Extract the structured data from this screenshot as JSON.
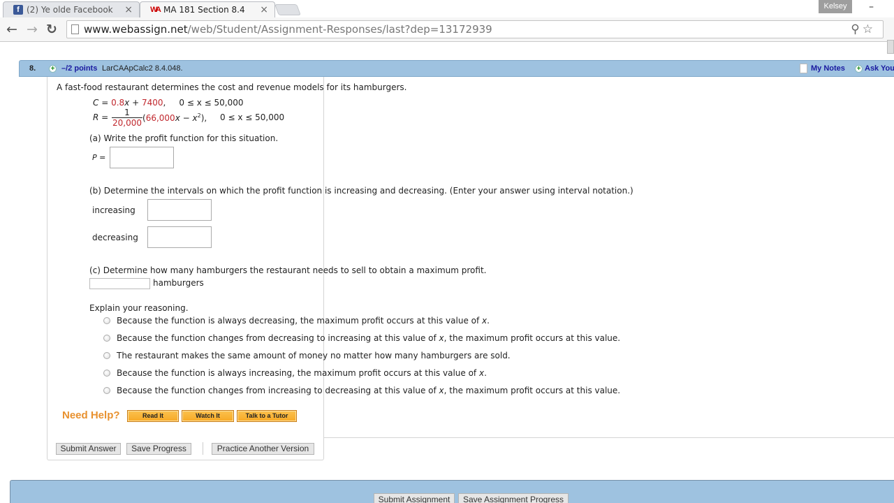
{
  "browser": {
    "tabs": [
      {
        "label": "(2) Ye olde Facebook",
        "favicon": "facebook-icon",
        "active": false
      },
      {
        "label": "MA 181 Section 8.4",
        "favicon": "webassign-icon",
        "active": true
      }
    ],
    "user_name": "Kelsey",
    "url_host": "www.webassign.net",
    "url_path": "/web/Student/Assignment-Responses/last?dep=13172939"
  },
  "question": {
    "number": "8.",
    "points": "–/2 points",
    "source": "LarCAApCalc2 8.4.048.",
    "my_notes": "My Notes",
    "ask_teacher": "Ask You",
    "intro": "A fast-food restaurant determines the cost and revenue models for its hamburgers.",
    "cost": {
      "label": "C = ",
      "coef": "0.8",
      "var": "x",
      "plus": " + ",
      "const": "7400",
      "domain": ",     0 ≤ x ≤ 50,000"
    },
    "revenue": {
      "label": "R = ",
      "frac_num": "1",
      "frac_den": "20,000",
      "paren_open": "(",
      "term1": "66,000",
      "var": "x",
      "minus": " − x",
      "exp": "2",
      "paren_close": "),",
      "domain": "0 ≤ x ≤ 50,000"
    },
    "part_a": {
      "prompt": "(a) Write the profit function for this situation.",
      "label": "P =",
      "value": ""
    },
    "part_b": {
      "prompt": "(b) Determine the intervals on which the profit function is increasing and decreasing. (Enter your answer using interval notation.)",
      "increasing_label": "increasing",
      "increasing_value": "",
      "decreasing_label": "decreasing",
      "decreasing_value": ""
    },
    "part_c": {
      "prompt": "(c) Determine how many hamburgers the restaurant needs to sell to obtain a maximum profit.",
      "unit": "hamburgers",
      "value": "",
      "explain": "Explain your reasoning.",
      "options": [
        {
          "text": "Because the function is always decreasing, the maximum profit occurs at this value of ",
          "var": "x",
          "tail": ".",
          "selected": false
        },
        {
          "text": "Because the function changes from decreasing to increasing at this value of ",
          "var": "x",
          "tail": ", the maximum profit occurs at this value.",
          "selected": false
        },
        {
          "text": "The restaurant makes the same amount of money no matter how many hamburgers are sold.",
          "var": "",
          "tail": "",
          "selected": false
        },
        {
          "text": "Because the function is always increasing, the maximum profit occurs at this value of ",
          "var": "x",
          "tail": ".",
          "selected": false
        },
        {
          "text": "Because the function changes from increasing to decreasing at this value of ",
          "var": "x",
          "tail": ", the maximum profit occurs at this value.",
          "selected": false
        }
      ]
    },
    "help": {
      "label": "Need Help?",
      "read_it": "Read It",
      "watch_it": "Watch It",
      "tutor": "Talk to a Tutor"
    },
    "actions": {
      "submit": "Submit Answer",
      "save": "Save Progress",
      "practice": "Practice Another Version"
    }
  },
  "assignment": {
    "submit": "Submit Assignment",
    "save": "Save Assignment Progress"
  },
  "colors": {
    "header_blue": "#9ec2e0",
    "link_blue": "#1a1aa0",
    "math_red": "#c0272d",
    "help_orange": "#e8912f"
  }
}
